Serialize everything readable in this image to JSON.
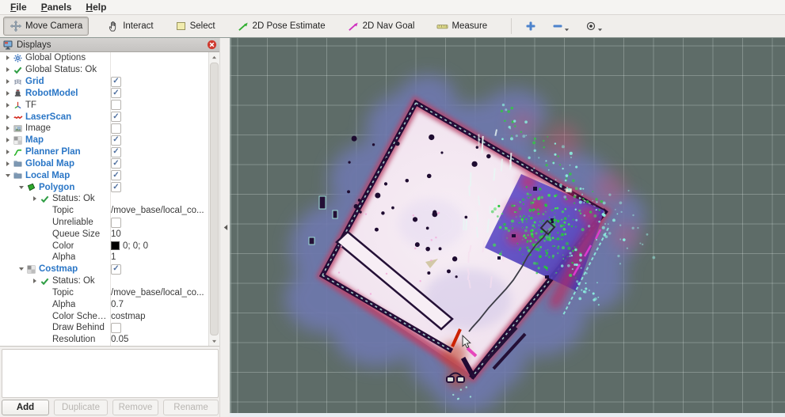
{
  "window": {
    "menu": [
      {
        "label": "File"
      },
      {
        "label": "Panels"
      },
      {
        "label": "Help"
      }
    ]
  },
  "toolbar": {
    "tools": [
      {
        "label": "Move Camera",
        "icon": "move-icon",
        "active": true
      },
      {
        "label": "Interact",
        "icon": "hand-icon",
        "active": false
      },
      {
        "label": "Select",
        "icon": "select-icon",
        "active": false
      },
      {
        "label": "2D Pose Estimate",
        "icon": "pose-arrow-icon",
        "active": false
      },
      {
        "label": "2D Nav Goal",
        "icon": "nav-arrow-icon",
        "active": false
      },
      {
        "label": "Measure",
        "icon": "measure-icon",
        "active": false
      }
    ],
    "view_controls": [
      {
        "name": "zoom-in-button",
        "icon": "plus-icon",
        "caret": false
      },
      {
        "name": "zoom-out-button",
        "icon": "minus-icon",
        "caret": true
      },
      {
        "name": "focus-camera-button",
        "icon": "focus-icon",
        "caret": true
      }
    ]
  },
  "displays_panel": {
    "title": "Displays",
    "tree": [
      {
        "level": 0,
        "expander": "right",
        "icon": "gear-icon",
        "label": "Global Options",
        "style": "plain",
        "check": null,
        "value": null,
        "swatch": false
      },
      {
        "level": 0,
        "expander": "right",
        "icon": "check-icon",
        "label": "Global Status: Ok",
        "style": "plain",
        "check": null,
        "value": null,
        "swatch": false
      },
      {
        "level": 0,
        "expander": "right",
        "icon": "grid-icon",
        "label": "Grid",
        "style": "display",
        "check": "on",
        "value": null,
        "swatch": false
      },
      {
        "level": 0,
        "expander": "right",
        "icon": "robot-icon",
        "label": "RobotModel",
        "style": "display",
        "check": "on",
        "value": null,
        "swatch": false
      },
      {
        "level": 0,
        "expander": "right",
        "icon": "axes-icon",
        "label": "TF",
        "style": "plain",
        "check": "off",
        "value": null,
        "swatch": false
      },
      {
        "level": 0,
        "expander": "right",
        "icon": "laser-icon",
        "label": "LaserScan",
        "style": "display",
        "check": "on",
        "value": null,
        "swatch": false
      },
      {
        "level": 0,
        "expander": "right",
        "icon": "image-icon",
        "label": "Image",
        "style": "plain",
        "check": "off",
        "value": null,
        "swatch": false
      },
      {
        "level": 0,
        "expander": "right",
        "icon": "map-icon",
        "label": "Map",
        "style": "display",
        "check": "on",
        "value": null,
        "swatch": false
      },
      {
        "level": 0,
        "expander": "right",
        "icon": "path-icon",
        "label": "Planner Plan",
        "style": "display",
        "check": "on",
        "value": null,
        "swatch": false
      },
      {
        "level": 0,
        "expander": "right",
        "icon": "folder-icon",
        "label": "Global Map",
        "style": "display",
        "check": "on",
        "value": null,
        "swatch": false
      },
      {
        "level": 0,
        "expander": "down",
        "icon": "folder-icon",
        "label": "Local Map",
        "style": "display",
        "check": "on",
        "value": null,
        "swatch": false
      },
      {
        "level": 1,
        "expander": "down",
        "icon": "polygon-icon",
        "label": "Polygon",
        "style": "display",
        "check": "on",
        "value": null,
        "swatch": false
      },
      {
        "level": 2,
        "expander": "right",
        "icon": "check-icon",
        "label": "Status: Ok",
        "style": "plain",
        "check": null,
        "value": null,
        "swatch": false
      },
      {
        "level": 3,
        "expander": null,
        "icon": null,
        "label": "Topic",
        "style": "plain",
        "check": null,
        "value": "/move_base/local_co...",
        "swatch": false
      },
      {
        "level": 3,
        "expander": null,
        "icon": null,
        "label": "Unreliable",
        "style": "plain",
        "check": "off",
        "value": null,
        "swatch": false
      },
      {
        "level": 3,
        "expander": null,
        "icon": null,
        "label": "Queue Size",
        "style": "plain",
        "check": null,
        "value": "10",
        "swatch": false
      },
      {
        "level": 3,
        "expander": null,
        "icon": null,
        "label": "Color",
        "style": "plain",
        "check": null,
        "value": "0; 0; 0",
        "swatch": true
      },
      {
        "level": 3,
        "expander": null,
        "icon": null,
        "label": "Alpha",
        "style": "plain",
        "check": null,
        "value": "1",
        "swatch": false
      },
      {
        "level": 1,
        "expander": "down",
        "icon": "costmap-icon",
        "label": "Costmap",
        "style": "display",
        "check": "on",
        "value": null,
        "swatch": false
      },
      {
        "level": 2,
        "expander": "right",
        "icon": "check-icon",
        "label": "Status: Ok",
        "style": "plain",
        "check": null,
        "value": null,
        "swatch": false
      },
      {
        "level": 3,
        "expander": null,
        "icon": null,
        "label": "Topic",
        "style": "plain",
        "check": null,
        "value": "/move_base/local_co...",
        "swatch": false
      },
      {
        "level": 3,
        "expander": null,
        "icon": null,
        "label": "Alpha",
        "style": "plain",
        "check": null,
        "value": "0.7",
        "swatch": false
      },
      {
        "level": 3,
        "expander": null,
        "icon": null,
        "label": "Color Scheme",
        "style": "plain",
        "check": null,
        "value": "costmap",
        "swatch": false
      },
      {
        "level": 3,
        "expander": null,
        "icon": null,
        "label": "Draw Behind",
        "style": "plain",
        "check": "off",
        "value": null,
        "swatch": false
      },
      {
        "level": 3,
        "expander": null,
        "icon": null,
        "label": "Resolution",
        "style": "plain",
        "check": null,
        "value": "0.05",
        "swatch": false
      }
    ],
    "buttons": [
      {
        "label": "Add",
        "enabled": true
      },
      {
        "label": "Duplicate",
        "enabled": false
      },
      {
        "label": "Remove",
        "enabled": false
      },
      {
        "label": "Rename",
        "enabled": false
      }
    ]
  },
  "colors": {
    "display_enabled_text": "#2a76c6",
    "checkmark": "#4f6f9f",
    "viewport_bg": "#5e6c68",
    "grid_line": "#93a39d",
    "inflation_blue": "#6e78ad",
    "wall": "#220a33",
    "room_fill": "#f2e6f0",
    "local_costmap_purple": "#5646be",
    "laser_green": "#2ecc40",
    "planned_path_gray": "#3c3c46",
    "goal_red": "#cc2200",
    "nav_magenta": "#e637b8"
  }
}
